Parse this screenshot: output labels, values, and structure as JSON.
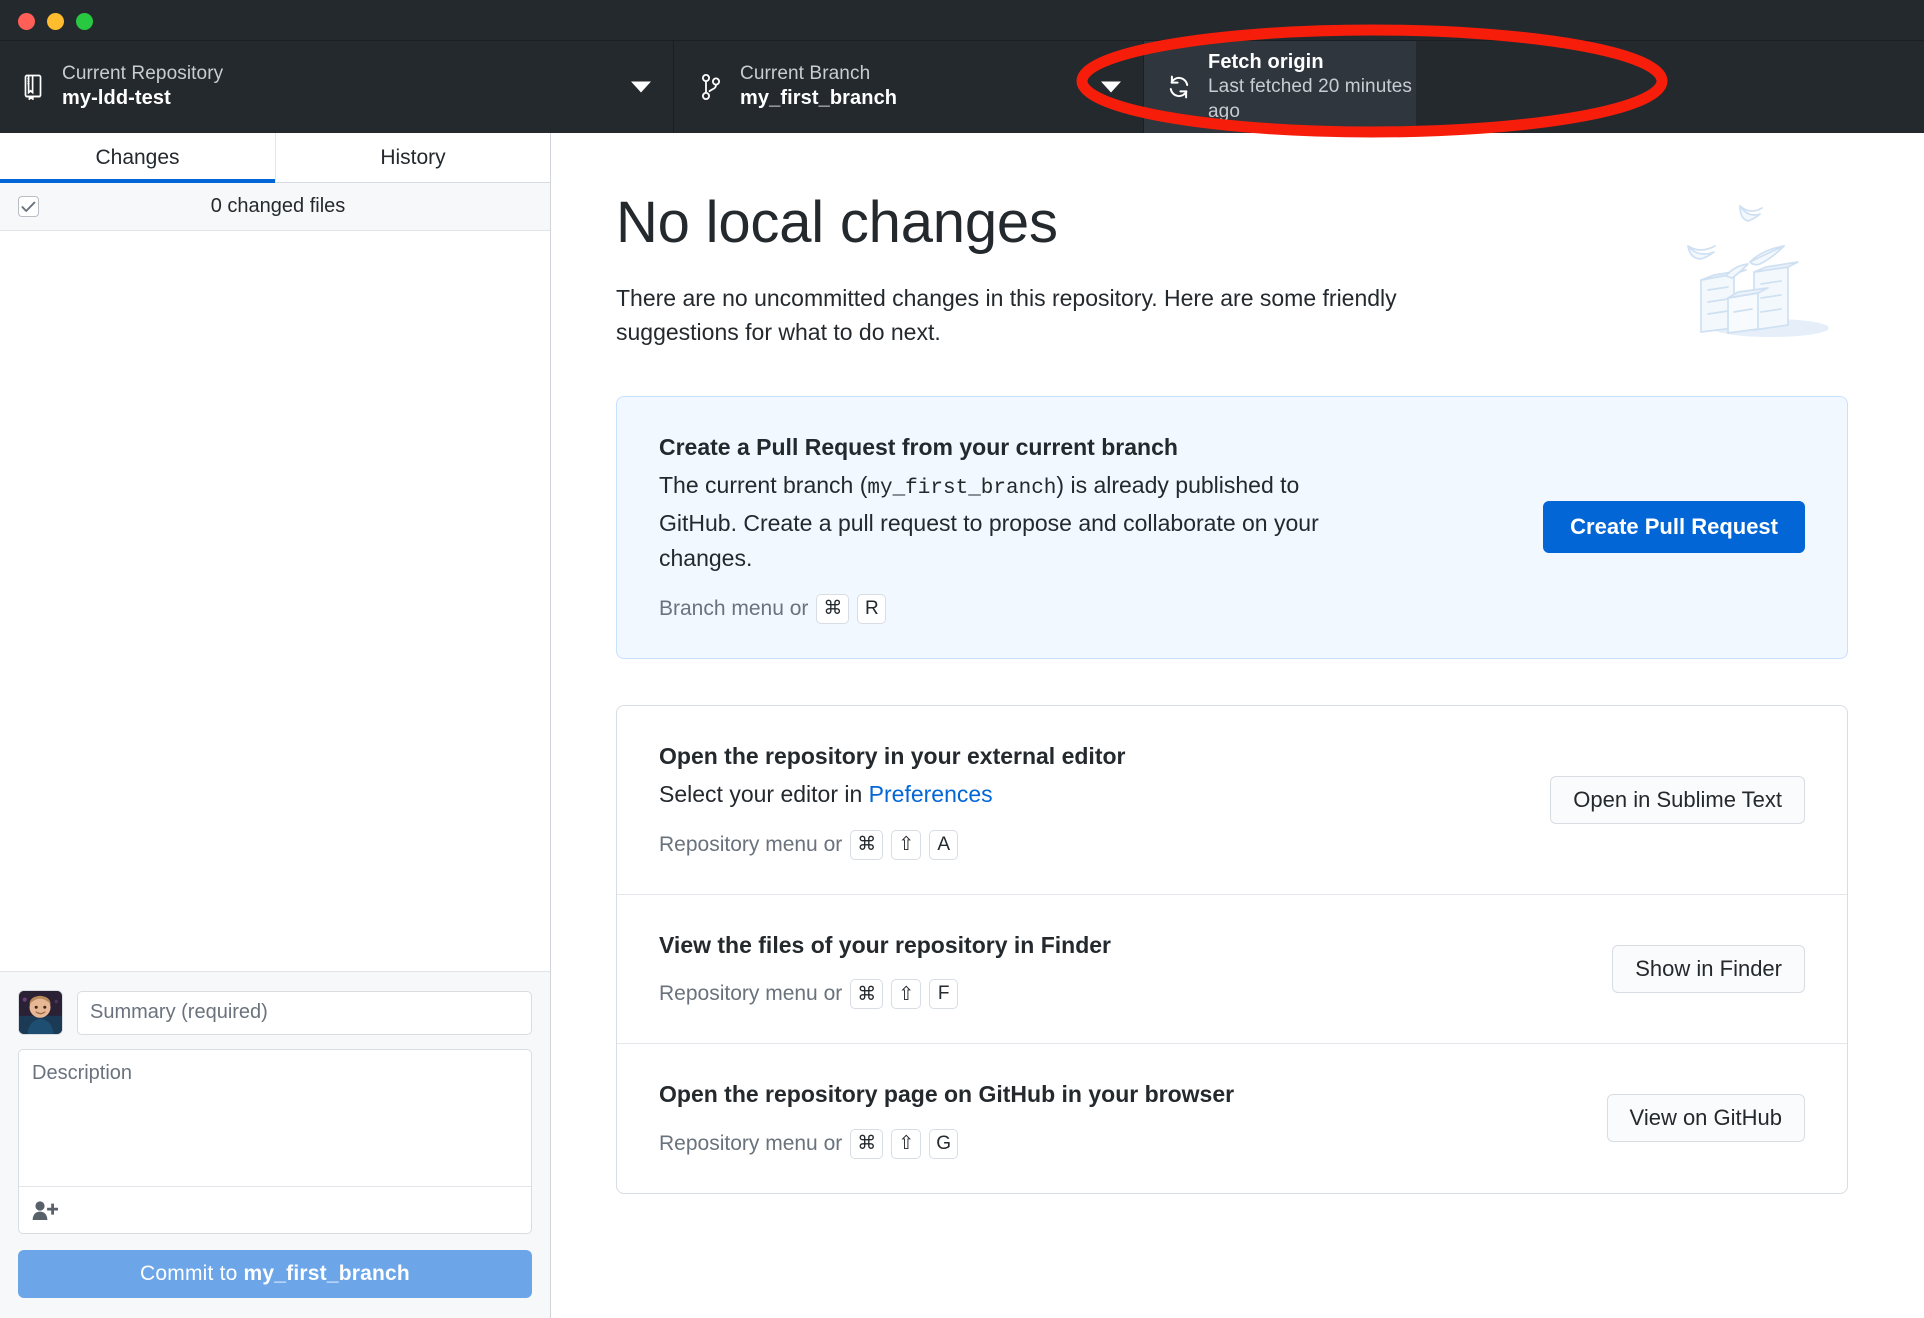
{
  "window": {
    "traffic_lights": [
      "close",
      "minimize",
      "maximize"
    ],
    "colors": {
      "close": "#ff5f57",
      "minimize": "#febc2e",
      "maximize": "#28c840"
    }
  },
  "toolbar": {
    "repository": {
      "label": "Current Repository",
      "value": "my-ldd-test",
      "icon": "repo-icon",
      "caret": "chevron-down-icon"
    },
    "branch": {
      "label": "Current Branch",
      "value": "my_first_branch",
      "icon": "branch-icon",
      "caret": "chevron-down-icon"
    },
    "fetch": {
      "label": "Fetch origin",
      "value": "Last fetched 20 minutes ago",
      "icon": "sync-icon"
    }
  },
  "sidebar": {
    "tabs": [
      {
        "label": "Changes",
        "active": true
      },
      {
        "label": "History",
        "active": false
      }
    ],
    "changed_files": {
      "label": "0 changed files",
      "checkbox_state": "checked"
    },
    "composer": {
      "summary_placeholder": "Summary (required)",
      "summary_value": "",
      "description_placeholder": "Description",
      "description_value": "",
      "coauthor_icon": "add-person-icon",
      "commit_button_prefix": "Commit to ",
      "commit_button_branch": "my_first_branch"
    }
  },
  "main": {
    "title": "No local changes",
    "subtitle": "There are no uncommitted changes in this repository. Here are some friendly suggestions for what to do next.",
    "illustration": "stacked-boxes-illustration",
    "pull_request_card": {
      "title": "Create a Pull Request from your current branch",
      "desc_part1": "The current branch (",
      "desc_branch": "my_first_branch",
      "desc_part2": ") is already published to GitHub. Create a pull request to propose and collaborate on your changes.",
      "menu_hint": "Branch menu or",
      "keys": [
        "⌘",
        "R"
      ],
      "button": "Create Pull Request"
    },
    "actions": [
      {
        "title": "Open the repository in your external editor",
        "desc_prefix": "Select your editor in ",
        "desc_link": "Preferences",
        "menu_hint": "Repository menu or",
        "keys": [
          "⌘",
          "⇧",
          "A"
        ],
        "button": "Open in Sublime Text"
      },
      {
        "title": "View the files of your repository in Finder",
        "desc_prefix": "",
        "desc_link": "",
        "menu_hint": "Repository menu or",
        "keys": [
          "⌘",
          "⇧",
          "F"
        ],
        "button": "Show in Finder"
      },
      {
        "title": "Open the repository page on GitHub in your browser",
        "desc_prefix": "",
        "desc_link": "",
        "menu_hint": "Repository menu or",
        "keys": [
          "⌘",
          "⇧",
          "G"
        ],
        "button": "View on GitHub"
      }
    ]
  },
  "annotation": {
    "shape": "ellipse",
    "color": "#f61e0a",
    "target": "fetch-origin-button"
  },
  "colors": {
    "toolbar_bg": "#24292e",
    "toolbar_active_bg": "#2f363d",
    "accent": "#0366d6",
    "commit_button": "#6ca6e8",
    "highlight_card_bg": "#f1f8ff",
    "annotation_red": "#f61e0a"
  }
}
